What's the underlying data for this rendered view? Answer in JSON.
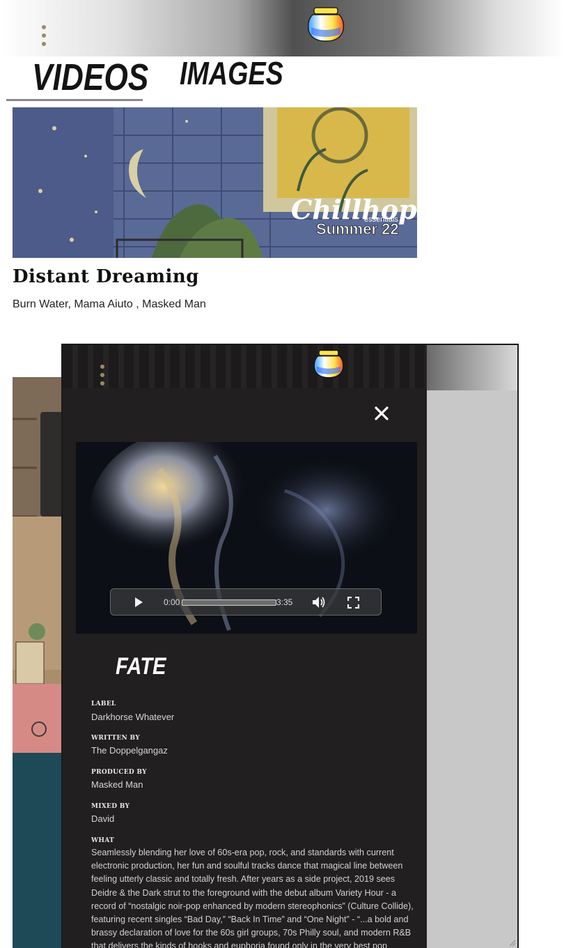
{
  "header": {
    "menu_icon": "kebab-menu-icon",
    "logo_icon": "jar-logo-icon"
  },
  "tabs": [
    {
      "label": "VIDEOS",
      "active": true
    },
    {
      "label": "IMAGES",
      "active": false
    }
  ],
  "cards": [
    {
      "title": "Distant Dreaming",
      "artists": "Burn Water, Mama Aiuto , Masked Man",
      "thumbnail_text_1": "Chillhop",
      "thumbnail_text_2": "essentials",
      "thumbnail_text_3": "Summer 22"
    }
  ],
  "modal": {
    "close_icon": "close-icon",
    "video": {
      "current_time": "0:00",
      "duration": "3:35",
      "progress": 0.0,
      "play_icon": "play-icon",
      "volume_icon": "volume-icon",
      "fullscreen_icon": "fullscreen-icon"
    },
    "title": "FATE",
    "details": [
      {
        "label": "LABEL",
        "value": "Darkhorse Whatever"
      },
      {
        "label": "WRITTEN BY",
        "value": "The Doppelgangaz"
      },
      {
        "label": "PRODUCED BY",
        "value": "Masked Man"
      },
      {
        "label": "MIXED BY",
        "value": "David"
      }
    ],
    "what_label": "WHAT",
    "what_text": "Seamlessly blending her love of 60s-era pop, rock, and standards with current electronic production, her fun and soulful tracks dance that magical line between feeling utterly classic and totally fresh. After years as a side project, 2019 sees Deidre & the Dark strut to the foreground with the debut album Variety Hour - a record of “nostalgic noir-pop enhanced by modern stereophonics” (Culture Collide), featuring recent singles “Bad Day,” “Back In Time” and “One Night” - “...a bold and brassy declaration of love for the 60s girl groups, 70s Philly soul, and modern R&B that delivers the kinds of hooks and euphoria found only in the very best pop records.” (WFMU, Sheila B)"
  },
  "colors": {
    "kebab": "#9c8a63",
    "modal_bg": "#221f20",
    "page_bg": "#ffffff",
    "text_dark": "#111111"
  }
}
